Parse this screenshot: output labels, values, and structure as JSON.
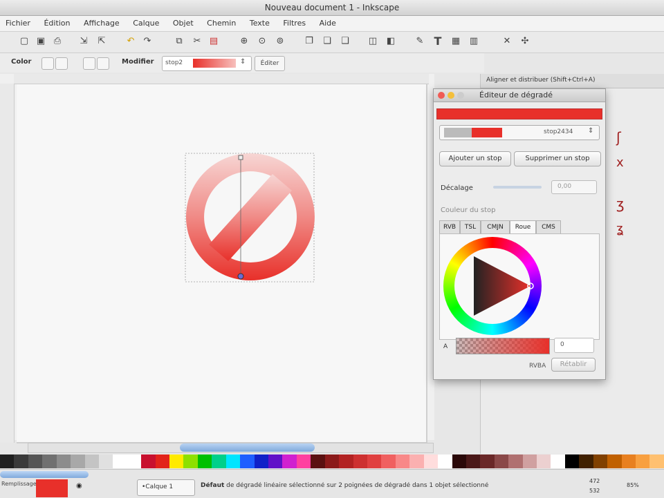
{
  "window": {
    "title": "Nouveau document 1 - Inkscape"
  },
  "menu": [
    "Fichier",
    "Édition",
    "Affichage",
    "Calque",
    "Objet",
    "Chemin",
    "Texte",
    "Filtres",
    "Aide"
  ],
  "ctrl": {
    "label": "Color",
    "modify_label": "Modifier",
    "stop_value": "stop2",
    "edit_label": "Éditer"
  },
  "side_panel": {
    "title": "Aligner et distribuer (Shift+Ctrl+A)"
  },
  "dialog": {
    "title": "Éditeur de dégradé",
    "stop_label": "stop2434",
    "add_stop": "Ajouter un stop",
    "remove_stop": "Supprimer un stop",
    "offset_label": "Décalage",
    "offset_value": "0,00",
    "color_section": "Couleur du stop",
    "tabs": [
      "RVB",
      "TSL",
      "CMJN",
      "Roue",
      "CMS"
    ],
    "alpha_label": "A",
    "alpha_value": "0",
    "footer_a": "RVBA",
    "footer_b": "Rétablir"
  },
  "status": {
    "left_label": "Remplissage",
    "layer": "•Calque 1",
    "message_bold": "Défaut",
    "message": "de dégradé linéaire sélectionné sur 2 poignées de dégradé dans 1 objet sélectionné",
    "x": "472",
    "y": "532",
    "zoom": "85%"
  },
  "palette_colors": [
    "#202020",
    "#3a3a3a",
    "#555",
    "#707070",
    "#8c8c8c",
    "#a8a8a8",
    "#c4c4c4",
    "#e0e0e0",
    "#ffffff",
    "#ffffff",
    "#c8102e",
    "#e2231a",
    "#ffea00",
    "#8ee000",
    "#00c000",
    "#00d08a",
    "#00e5ff",
    "#1e5eff",
    "#1020c8",
    "#6010c8",
    "#d020d0",
    "#ff40a0",
    "#5a1010",
    "#8b1a1a",
    "#b22222",
    "#cd3030",
    "#e04040",
    "#f06060",
    "#f88888",
    "#fbb0b0",
    "#fdd",
    "#ffffff",
    "#2a0808",
    "#4a1818",
    "#6a2828",
    "#8a4848",
    "#b07070",
    "#d0a0a0",
    "#ecd0d0",
    "#ffffff",
    "#000",
    "#402000",
    "#804000",
    "#c06000",
    "#e88020",
    "#f8a040",
    "#ffc070"
  ],
  "accent": "#e8302a"
}
